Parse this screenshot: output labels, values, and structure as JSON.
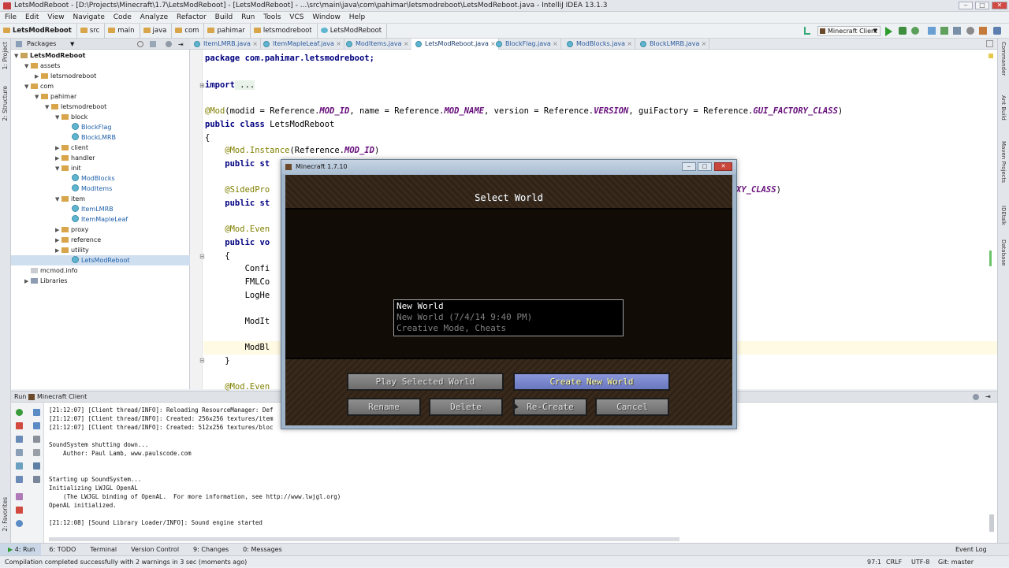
{
  "window": {
    "title": "LetsModReboot - [D:\\Projects\\Minecraft\\1.7\\LetsModReboot] - [LetsModReboot] - ...\\src\\main\\java\\com\\pahimar\\letsmodreboot\\LetsModReboot.java - IntelliJ IDEA 13.1.3"
  },
  "menu": [
    "File",
    "Edit",
    "View",
    "Navigate",
    "Code",
    "Analyze",
    "Refactor",
    "Build",
    "Run",
    "Tools",
    "VCS",
    "Window",
    "Help"
  ],
  "breadcrumbs": [
    "LetsModReboot",
    "src",
    "main",
    "java",
    "com",
    "pahimar",
    "letsmodreboot",
    "LetsModReboot"
  ],
  "run_config": "Minecraft Client",
  "left_tabs": [
    "1: Project",
    "2: Structure",
    "2: Favorites"
  ],
  "right_tabs": [
    "Commander",
    "Ant Build",
    "Maven Projects",
    "IDEtalk",
    "Database"
  ],
  "project_panel": {
    "view": "Packages",
    "tree": [
      {
        "label": "LetsModReboot",
        "type": "module",
        "depth": 0,
        "open": true
      },
      {
        "label": "assets",
        "type": "dir",
        "depth": 1,
        "open": true
      },
      {
        "label": "letsmodreboot",
        "type": "dir",
        "depth": 2,
        "open": false
      },
      {
        "label": "com",
        "type": "dir",
        "depth": 1,
        "open": true
      },
      {
        "label": "pahimar",
        "type": "dir",
        "depth": 2,
        "open": true
      },
      {
        "label": "letsmodreboot",
        "type": "dir",
        "depth": 3,
        "open": true
      },
      {
        "label": "block",
        "type": "dir",
        "depth": 4,
        "open": true
      },
      {
        "label": "BlockFlag",
        "type": "class",
        "depth": 5
      },
      {
        "label": "BlockLMRB",
        "type": "class",
        "depth": 5
      },
      {
        "label": "client",
        "type": "dir",
        "depth": 4,
        "open": false
      },
      {
        "label": "handler",
        "type": "dir",
        "depth": 4,
        "open": false
      },
      {
        "label": "init",
        "type": "dir",
        "depth": 4,
        "open": true
      },
      {
        "label": "ModBlocks",
        "type": "class",
        "depth": 5
      },
      {
        "label": "ModItems",
        "type": "class",
        "depth": 5
      },
      {
        "label": "item",
        "type": "dir",
        "depth": 4,
        "open": true
      },
      {
        "label": "ItemLMRB",
        "type": "class",
        "depth": 5
      },
      {
        "label": "ItemMapleLeaf",
        "type": "class",
        "depth": 5
      },
      {
        "label": "proxy",
        "type": "dir",
        "depth": 4,
        "open": false
      },
      {
        "label": "reference",
        "type": "dir",
        "depth": 4,
        "open": false
      },
      {
        "label": "utility",
        "type": "dir",
        "depth": 4,
        "open": false
      },
      {
        "label": "LetsModReboot",
        "type": "class",
        "depth": 5,
        "selected": true
      },
      {
        "label": "mcmod.info",
        "type": "file",
        "depth": 1
      },
      {
        "label": "Libraries",
        "type": "lib",
        "depth": 1,
        "open": false
      }
    ]
  },
  "editor_tabs": [
    "ItemLMRB.java",
    "ItemMapleLeaf.java",
    "ModItems.java",
    "LetsModReboot.java",
    "BlockFlag.java",
    "ModBlocks.java",
    "BlockLMRB.java"
  ],
  "active_editor_tab": "LetsModReboot.java",
  "code": {
    "l1": "package com.pahimar.letsmodreboot;",
    "l2_kw": "import",
    "l2_rest": " ...",
    "l3_ann": "@Mod",
    "l3_a": "(modid = Reference.",
    "l3_i1": "MOD_ID",
    "l3_b": ", name = Reference.",
    "l3_i2": "MOD_NAME",
    "l3_c": ", version = Reference.",
    "l3_i3": "VERSION",
    "l3_d": ", guiFactory = Reference.",
    "l3_i4": "GUI_FACTORY_CLASS",
    "l3_e": ")",
    "l4_kw": "public class",
    "l4_rest": " LetsModReboot",
    "l5": "{",
    "l6_ann": "    @Mod.Instance",
    "l6_a": "(Reference.",
    "l6_i": "MOD_ID",
    "l6_b": ")",
    "l7_kw": "    public st",
    "l8_ann": "    @SidedPro",
    "l8_tail": "XY_CLASS",
    "l8_tail2": ")",
    "l9_kw": "    public st",
    "l10_ann": "    @Mod.Even",
    "l11_kw": "    public vo",
    "l12": "    {",
    "l13": "        Confi",
    "l14": "        FMLCo",
    "l15": "        LogHe",
    "l16": "        ModIt",
    "l17": "        ModBl",
    "l18": "    }",
    "l19_ann": "    @Mod.Even"
  },
  "run_panel": {
    "header_label": "Run",
    "config": "Minecraft Client",
    "log": [
      "[21:12:07] [Client thread/INFO]: Reloading ResourceManager: Def",
      "[21:12:07] [Client thread/INFO]: Created: 256x256 textures/item",
      "[21:12:07] [Client thread/INFO]: Created: 512x256 textures/bloc",
      "",
      "SoundSystem shutting down...",
      "    Author: Paul Lamb, www.paulscode.com",
      "",
      "",
      "Starting up SoundSystem...",
      "Initializing LWJGL OpenAL",
      "    (The LWJGL binding of OpenAL.  For more information, see http://www.lwjgl.org)",
      "OpenAL initialized.",
      "",
      "[21:12:08] [Sound Library Loader/INFO]: Sound engine started"
    ]
  },
  "bottom_tabs": [
    "4: Run",
    "6: TODO",
    "Terminal",
    "Version Control",
    "9: Changes",
    "0: Messages"
  ],
  "event_log": "Event Log",
  "status": {
    "message": "Compilation completed successfully with 2 warnings in 3 sec (moments ago)",
    "position": "97:1",
    "line_sep": "CRLF",
    "encoding": "UTF-8",
    "vcs": "Git: master"
  },
  "minecraft": {
    "window_title": "Minecraft 1.7.10",
    "heading": "Select World",
    "world": {
      "name": "New World",
      "details": "New World (7/4/14 9:40 PM)",
      "mode": "Creative Mode, Cheats"
    },
    "buttons": {
      "play": "Play Selected World",
      "create": "Create New World",
      "rename": "Rename",
      "delete": "Delete",
      "recreate": "Re-Create",
      "cancel": "Cancel"
    }
  },
  "colors": {
    "keyword": "#000080",
    "annotation": "#808000",
    "constant": "#660e7a",
    "mc_highlight": "#ffffa0"
  }
}
